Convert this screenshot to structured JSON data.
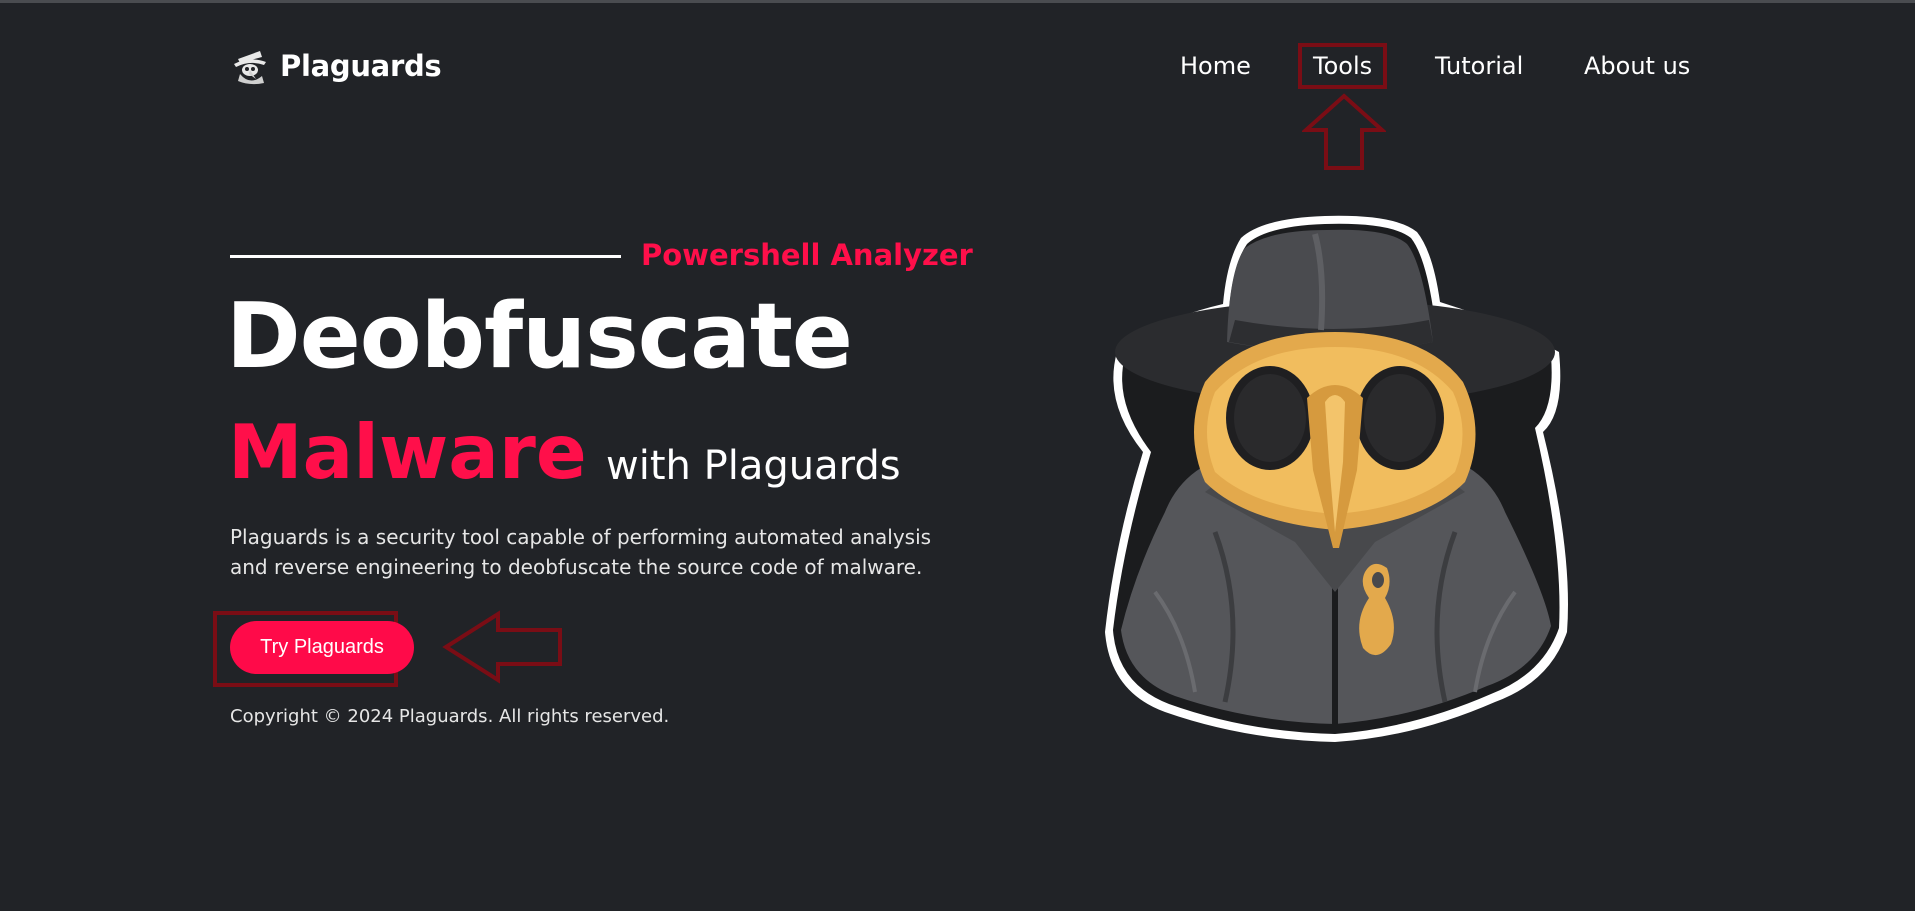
{
  "brand": {
    "name": "Plaguards",
    "logo_icon": "plague-doctor-icon"
  },
  "nav": {
    "items": [
      {
        "label": "Home"
      },
      {
        "label": "Tools"
      },
      {
        "label": "Tutorial"
      },
      {
        "label": "About us"
      }
    ]
  },
  "hero": {
    "eyebrow": "Powershell Analyzer",
    "headline": "Deobfuscate",
    "headline_accent": "Malware",
    "headline_suffix": "with Plaguards",
    "description": "Plaguards is a security tool capable of performing automated analysis and reverse engineering to deobfuscate the source code of malware.",
    "cta_label": "Try Plaguards",
    "mascot_icon": "plague-doctor-mascot"
  },
  "footer": {
    "copyright": "Copyright © 2024 Plaguards. All rights reserved."
  },
  "annotations": {
    "up_arrow_icon": "arrow-up-outline-icon",
    "left_arrow_icon": "arrow-left-outline-icon"
  },
  "colors": {
    "background": "#212327",
    "accent": "#ff0a49",
    "annotation": "#7a0d15",
    "text": "#ffffff"
  }
}
